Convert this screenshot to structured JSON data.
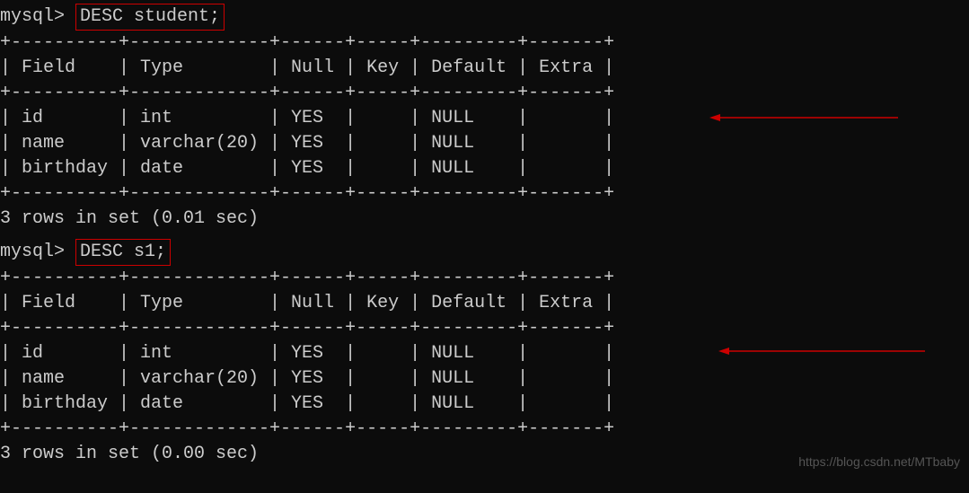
{
  "chart_data": [
    {
      "type": "table",
      "title": "DESC student;",
      "columns": [
        "Field",
        "Type",
        "Null",
        "Key",
        "Default",
        "Extra"
      ],
      "rows": [
        {
          "Field": "id",
          "Type": "int",
          "Null": "YES",
          "Key": "",
          "Default": "NULL",
          "Extra": ""
        },
        {
          "Field": "name",
          "Type": "varchar(20)",
          "Null": "YES",
          "Key": "",
          "Default": "NULL",
          "Extra": ""
        },
        {
          "Field": "birthday",
          "Type": "date",
          "Null": "YES",
          "Key": "",
          "Default": "NULL",
          "Extra": ""
        }
      ]
    },
    {
      "type": "table",
      "title": "DESC s1;",
      "columns": [
        "Field",
        "Type",
        "Null",
        "Key",
        "Default",
        "Extra"
      ],
      "rows": [
        {
          "Field": "id",
          "Type": "int",
          "Null": "YES",
          "Key": "",
          "Default": "NULL",
          "Extra": ""
        },
        {
          "Field": "name",
          "Type": "varchar(20)",
          "Null": "YES",
          "Key": "",
          "Default": "NULL",
          "Extra": ""
        },
        {
          "Field": "birthday",
          "Type": "date",
          "Null": "YES",
          "Key": "",
          "Default": "NULL",
          "Extra": ""
        }
      ]
    }
  ],
  "query1": {
    "prompt": "mysql> ",
    "command": "DESC student;",
    "sep_top": "+----------+-------------+------+-----+---------+-------+",
    "header": "| Field    | Type        | Null | Key | Default | Extra |",
    "sep_mid": "+----------+-------------+------+-----+---------+-------+",
    "row1": "| id       | int         | YES  |     | NULL    |       |",
    "row2": "| name     | varchar(20) | YES  |     | NULL    |       |",
    "row3": "| birthday | date        | YES  |     | NULL    |       |",
    "sep_bot": "+----------+-------------+------+-----+---------+-------+",
    "status": "3 rows in set (0.01 sec)"
  },
  "query2": {
    "prompt": "mysql> ",
    "command": "DESC s1;",
    "sep_top": "+----------+-------------+------+-----+---------+-------+",
    "header": "| Field    | Type        | Null | Key | Default | Extra |",
    "sep_mid": "+----------+-------------+------+-----+---------+-------+",
    "row1": "| id       | int         | YES  |     | NULL    |       |",
    "row2": "| name     | varchar(20) | YES  |     | NULL    |       |",
    "row3": "| birthday | date        | YES  |     | NULL    |       |",
    "sep_bot": "+----------+-------------+------+-----+---------+-------+",
    "status": "3 rows in set (0.00 sec)"
  },
  "watermark": "https://blog.csdn.net/MTbaby"
}
